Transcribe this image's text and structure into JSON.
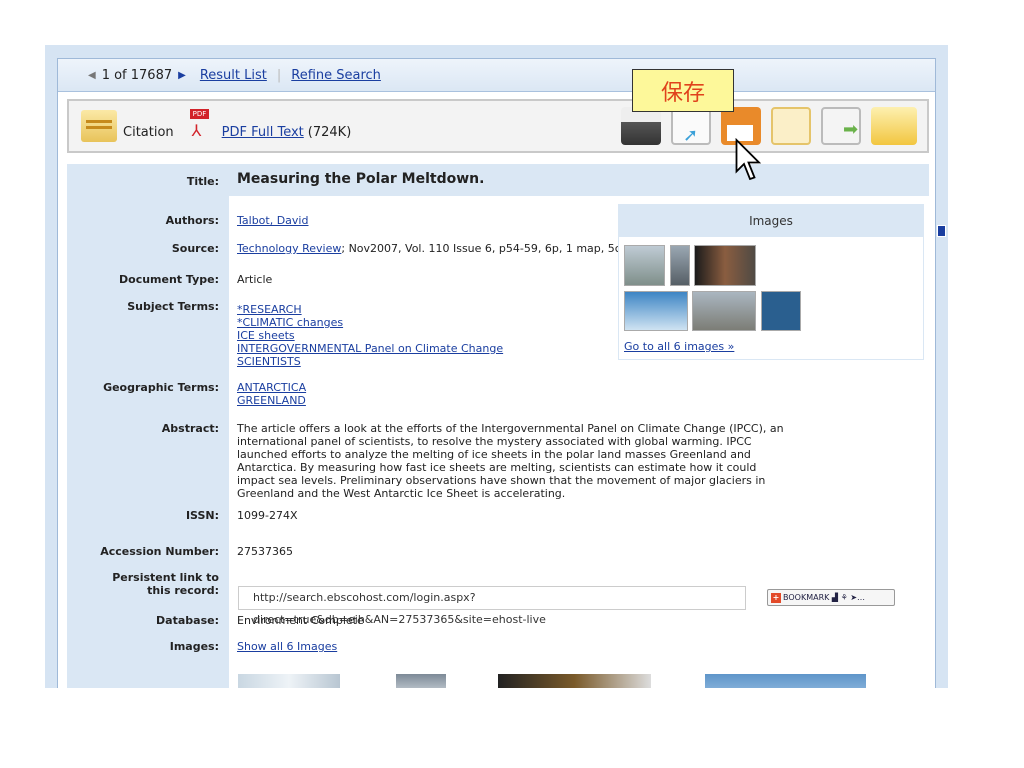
{
  "nav": {
    "position": "1 of 17687",
    "result_list": "Result List",
    "refine_search": "Refine Search"
  },
  "toolbar": {
    "citation": "Citation",
    "pdf_badge": "PDF",
    "pdf_link": "PDF Full Text",
    "pdf_size": "(724K)",
    "tooltip": "保存",
    "tools": [
      "print-icon",
      "email-icon",
      "save-icon",
      "cite-icon",
      "export-icon",
      "folder-icon"
    ]
  },
  "record": {
    "title_label": "Title:",
    "title": "Measuring the Polar Meltdown.",
    "authors_label": "Authors:",
    "author": "Talbot, David",
    "source_label": "Source:",
    "source_link": "Technology Review",
    "source_rest": "; Nov2007, Vol. 110 Issue 6, p54-59, 6p, 1 map, 5c",
    "doctype_label": "Document Type:",
    "doctype": "Article",
    "subject_label": "Subject Terms:",
    "subjects": [
      "*RESEARCH",
      "*CLIMATIC changes",
      "ICE sheets",
      "INTERGOVERNMENTAL Panel on Climate Change",
      "SCIENTISTS"
    ],
    "geo_label": "Geographic Terms:",
    "geo": [
      "ANTARCTICA",
      "GREENLAND"
    ],
    "abstract_label": "Abstract:",
    "abstract": "The article offers a look at the efforts of the Intergovernmental Panel on Climate Change (IPCC), an international panel of scientists, to resolve the mystery associated with global warming. IPCC launched efforts to analyze the melting of ice sheets in the polar land masses Greenland and Antarctica. By measuring how fast ice sheets are melting, scientists can estimate how it could impact sea levels. Preliminary observations have shown that the movement of major glaciers in Greenland and the West Antarctic Ice Sheet is accelerating.",
    "issn_label": "ISSN:",
    "issn": "1099-274X",
    "accession_label": "Accession Number:",
    "accession": "27537365",
    "link_label_1": "Persistent link to",
    "link_label_2": "this record:",
    "link": "http://search.ebscohost.com/login.aspx?direct=true&db=eih&AN=27537365&site=ehost-live",
    "bookmark": "BOOKMARK",
    "database_label": "Database:",
    "database": "Environment Complete",
    "images_label": "Images:",
    "images_link": "Show all 6 Images"
  },
  "images_panel": {
    "heading": "Images",
    "link": "Go to all 6 images »"
  }
}
